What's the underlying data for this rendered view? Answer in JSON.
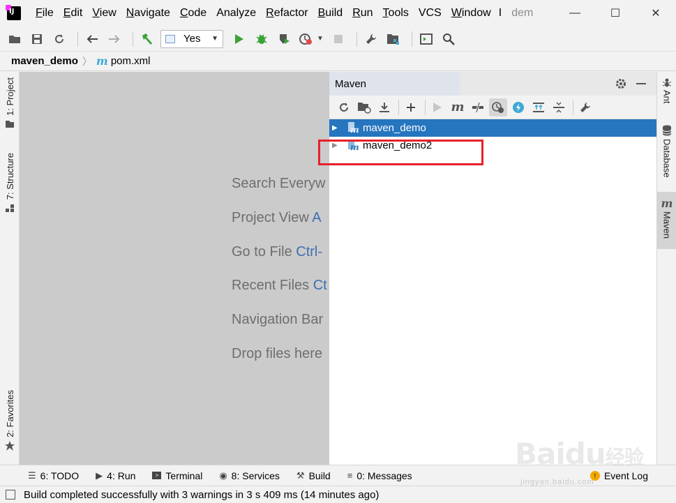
{
  "titlebar": {
    "menu": [
      {
        "label": "File",
        "mnemonic": "F",
        "rest": "ile"
      },
      {
        "label": "Edit",
        "mnemonic": "E",
        "rest": "dit"
      },
      {
        "label": "View",
        "mnemonic": "V",
        "rest": "iew"
      },
      {
        "label": "Navigate",
        "mnemonic": "N",
        "rest": "avigate"
      },
      {
        "label": "Code",
        "mnemonic": "C",
        "rest": "ode"
      },
      {
        "label": "Analyze",
        "mnemonic": "",
        "rest": "Analyze"
      },
      {
        "label": "Refactor",
        "mnemonic": "R",
        "rest": "efactor"
      },
      {
        "label": "Build",
        "mnemonic": "B",
        "rest": "uild"
      },
      {
        "label": "Run",
        "mnemonic": "R",
        "rest": "un"
      },
      {
        "label": "Tools",
        "mnemonic": "T",
        "rest": "ools"
      },
      {
        "label": "VCS",
        "mnemonic": "",
        "rest": "VCS"
      },
      {
        "label": "Window",
        "mnemonic": "W",
        "rest": "indow"
      },
      {
        "label": "H",
        "mnemonic": "",
        "rest": "I"
      }
    ],
    "title": "dem",
    "minimize": "—",
    "maximize": "☐",
    "close": "✕"
  },
  "toolbar": {
    "run_config": "Yes"
  },
  "breadcrumb": {
    "project": "maven_demo",
    "separator": "〉",
    "file_icon": "m",
    "file": "pom.xml"
  },
  "left_tabs": {
    "project": "1: Project",
    "structure": "7: Structure",
    "favorites": "2: Favorites"
  },
  "editor_hints": [
    {
      "text": "Search Everyw",
      "key": ""
    },
    {
      "text": "Project View ",
      "key": "A"
    },
    {
      "text": "Go to File ",
      "key": "Ctrl-"
    },
    {
      "text": "Recent Files ",
      "key": "Ct"
    },
    {
      "text": "Navigation Bar",
      "key": ""
    },
    {
      "text": "Drop files here",
      "key": ""
    }
  ],
  "maven": {
    "title": "Maven",
    "projects": [
      {
        "name": "maven_demo",
        "selected": true
      },
      {
        "name": "maven_demo2",
        "selected": false
      }
    ],
    "highlight_color": "#e8202a"
  },
  "right_tabs": {
    "ant": "Ant",
    "database": "Database",
    "maven": "Maven"
  },
  "bottom_tabs": [
    {
      "label": "6: TODO",
      "icon": "list-icon"
    },
    {
      "label": "4: Run",
      "icon": "play-icon"
    },
    {
      "label": "Terminal",
      "icon": "terminal-icon"
    },
    {
      "label": "8: Services",
      "icon": "services-icon"
    },
    {
      "label": "Build",
      "icon": "hammer-icon"
    },
    {
      "label": "0: Messages",
      "icon": "messages-icon"
    }
  ],
  "event_log": "Event Log",
  "status": "Build completed successfully with 3 warnings in 3 s 409 ms (14 minutes ago)",
  "watermark": {
    "text": "Bai",
    "text2": "du",
    "text3": "经验",
    "url": "jingyan.baidu.com"
  },
  "colors": {
    "selection": "#2675bf",
    "accent": "#3fa9d8",
    "run_green": "#3aa336"
  }
}
